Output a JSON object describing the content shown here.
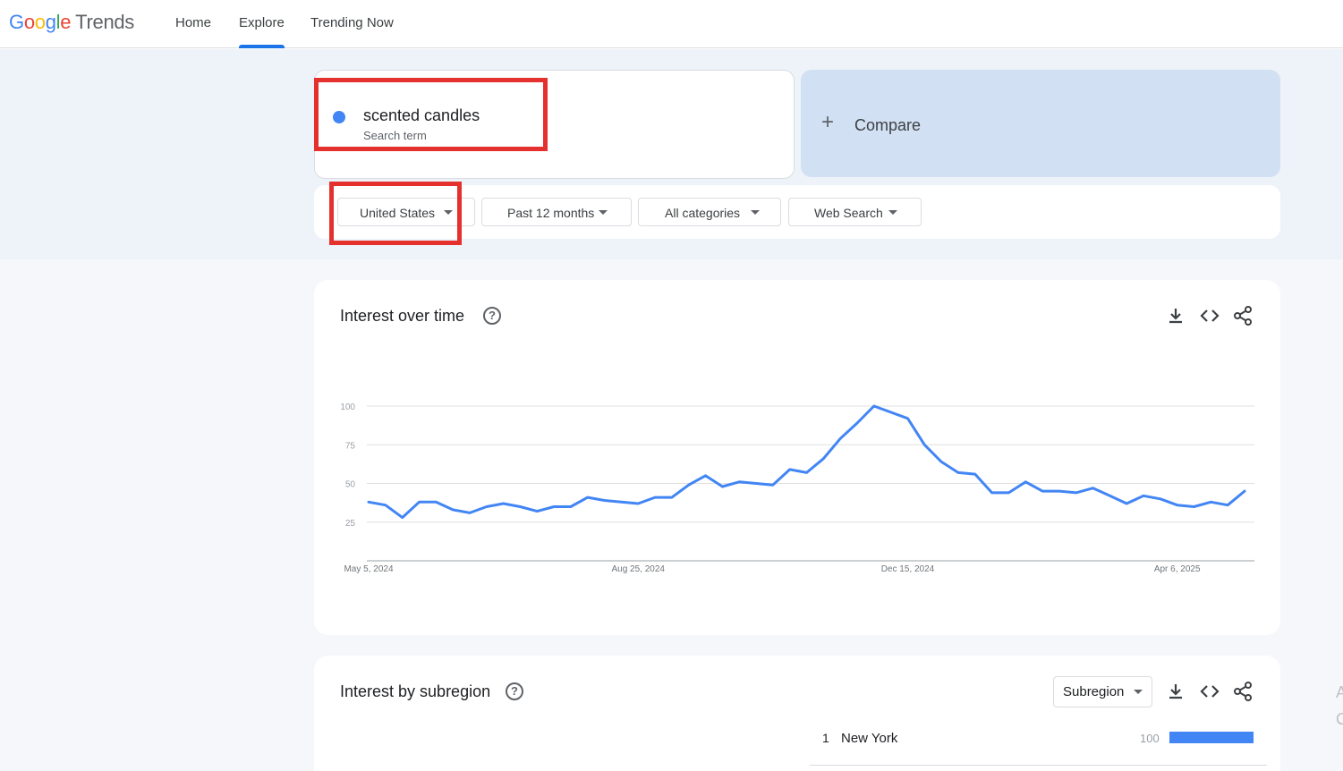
{
  "header": {
    "logo_letters": [
      "G",
      "o",
      "o",
      "g",
      "l",
      "e"
    ],
    "logo_product": "Trends",
    "nav": [
      "Home",
      "Explore",
      "Trending Now"
    ],
    "active_nav": "Explore"
  },
  "search": {
    "term": "scented candles",
    "term_type": "Search term",
    "term_color": "#4285f4",
    "compare_label": "Compare"
  },
  "filters": {
    "region": "United States",
    "time": "Past 12 months",
    "category": "All categories",
    "property": "Web Search"
  },
  "interest_over_time": {
    "title": "Interest over time",
    "icons": [
      "help-icon",
      "download-icon",
      "embed-icon",
      "share-icon"
    ]
  },
  "chart_data": {
    "type": "line",
    "title": "Interest over time",
    "xlabel": "",
    "ylabel": "",
    "ylim": [
      0,
      100
    ],
    "y_ticks": [
      25,
      50,
      75,
      100
    ],
    "x_tick_labels": [
      "May 5, 2024",
      "Aug 25, 2024",
      "Dec 15, 2024",
      "Apr 6, 2025"
    ],
    "grid": true,
    "series": [
      {
        "color": "#4285f4",
        "values": [
          38,
          36,
          28,
          38,
          38,
          33,
          31,
          35,
          37,
          35,
          32,
          35,
          35,
          41,
          39,
          38,
          37,
          41,
          41,
          49,
          55,
          48,
          51,
          50,
          49,
          59,
          57,
          66,
          79,
          89,
          100,
          96,
          92,
          75,
          64,
          57,
          56,
          44,
          44,
          51,
          45,
          45,
          44,
          47,
          42,
          37,
          42,
          40,
          36,
          35,
          38,
          36,
          45
        ]
      }
    ]
  },
  "interest_by_subregion": {
    "title": "Interest by subregion",
    "dropdown": "Subregion",
    "icons": [
      "help-icon",
      "download-icon",
      "embed-icon",
      "share-icon"
    ],
    "rows": [
      {
        "rank": "1",
        "name": "New York",
        "value": "100",
        "fraction": 1.0
      }
    ]
  }
}
